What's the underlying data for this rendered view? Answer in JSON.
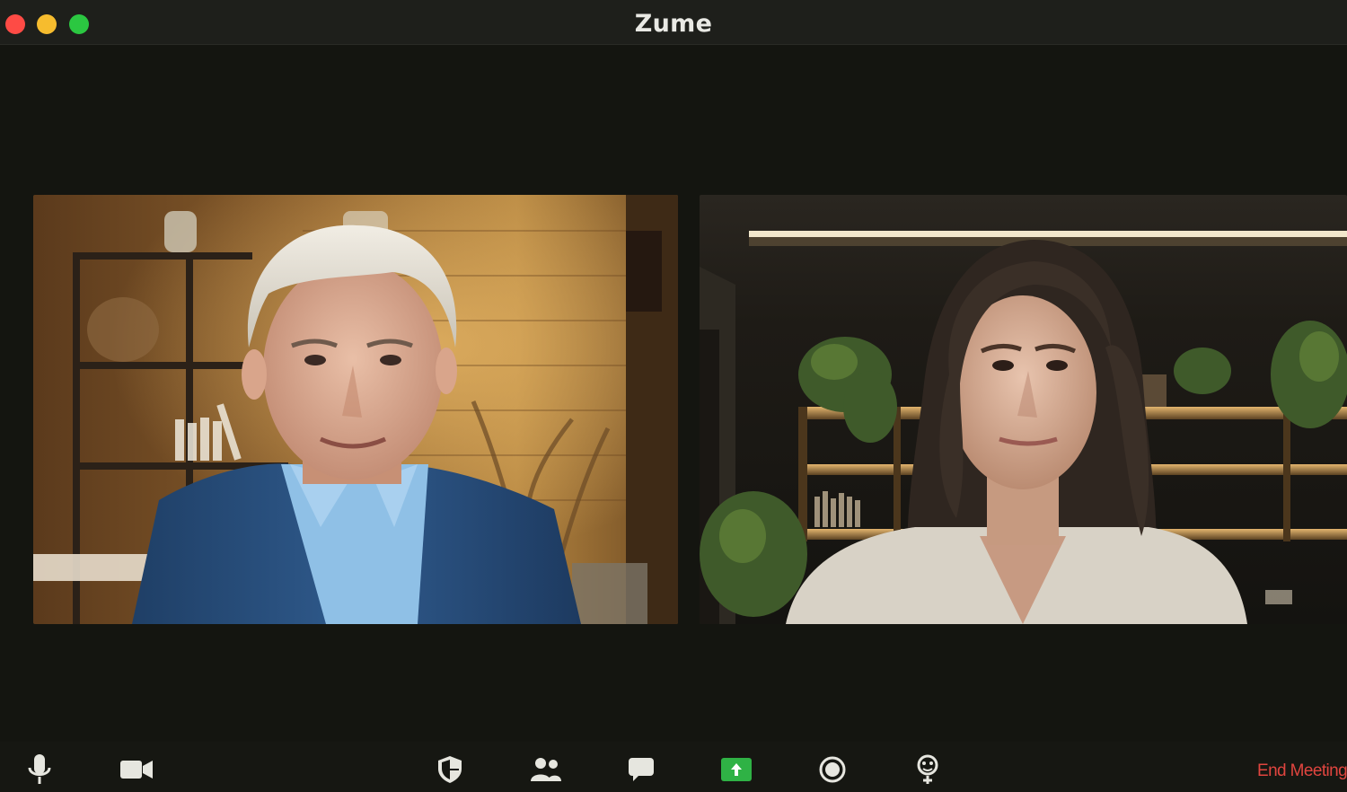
{
  "window": {
    "title": "Zume",
    "controls": [
      "close",
      "minimize",
      "zoom"
    ]
  },
  "video_tiles": [
    {
      "participant": "participant-1",
      "scene": "older man with grey hair, blue blazer, light blue shirt, warm wooden shelves behind"
    },
    {
      "participant": "participant-2",
      "scene": "woman with long dark hair, light sweater, dark room with lit shelves and plants"
    }
  ],
  "toolbar": {
    "items": [
      {
        "name": "mute-button",
        "icon": "microphone-icon"
      },
      {
        "name": "video-button",
        "icon": "video-camera-icon"
      },
      {
        "name": "security-button",
        "icon": "shield-icon"
      },
      {
        "name": "participants-button",
        "icon": "participants-icon"
      },
      {
        "name": "chat-button",
        "icon": "chat-bubble-icon"
      },
      {
        "name": "share-screen-button",
        "icon": "share-screen-icon",
        "accent": "#2fb245"
      },
      {
        "name": "record-button",
        "icon": "record-icon"
      },
      {
        "name": "reactions-button",
        "icon": "reactions-icon"
      }
    ],
    "end_meeting_label": "End Meeting",
    "end_meeting_color": "#e0453f"
  },
  "colors": {
    "background": "#141510",
    "titlebar": "#1e1f1b",
    "icon": "#e6e6df"
  }
}
